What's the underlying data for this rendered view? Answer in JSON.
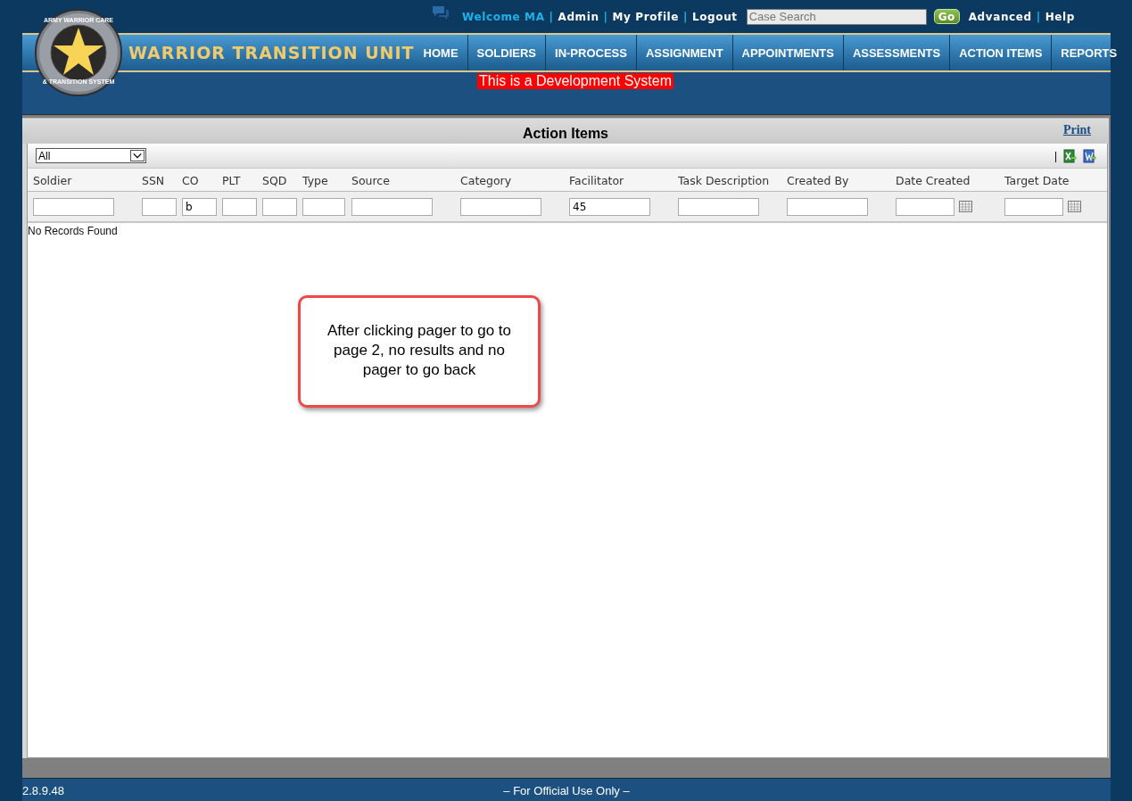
{
  "header": {
    "top_links": [
      {
        "kind": "welcome",
        "text": "Welcome MA"
      },
      {
        "kind": "sep",
        "text": "|"
      },
      {
        "kind": "link",
        "text": "Admin"
      },
      {
        "kind": "sep",
        "text": "|"
      },
      {
        "kind": "link",
        "text": "My Profile"
      },
      {
        "kind": "sep",
        "text": "|"
      },
      {
        "kind": "link",
        "text": "Logout"
      }
    ],
    "search": {
      "placeholder": "Case Search"
    },
    "go_button": "Go",
    "right_links": [
      {
        "kind": "link",
        "text": "Advanced"
      },
      {
        "kind": "sep",
        "text": "|"
      },
      {
        "kind": "link",
        "text": "Help"
      }
    ],
    "logo_ring_top": "ARMY WARRIOR CARE",
    "logo_ring_bottom": "& TRANSITION SYSTEM",
    "logo_text": "WARRIOR TRANSITION UNIT",
    "nav": [
      {
        "label": "HOME"
      },
      {
        "label": "SOLDIERS"
      },
      {
        "label": "IN-PROCESS"
      },
      {
        "label": "ASSIGNMENT"
      },
      {
        "label": "APPOINTMENTS"
      },
      {
        "label": "ASSESSMENTS"
      },
      {
        "label": "ACTION ITEMS"
      },
      {
        "label": "REPORTS"
      }
    ],
    "banner": "This is a Development System"
  },
  "panel": {
    "title": "Action Items",
    "print_link": "Print",
    "filter_select": "All",
    "toolbar_separator": "|",
    "columns": [
      {
        "label": "Soldier",
        "kind": "text"
      },
      {
        "label": "SSN",
        "kind": "text"
      },
      {
        "label": "CO",
        "kind": "text",
        "filter": "b"
      },
      {
        "label": "PLT",
        "kind": "text"
      },
      {
        "label": "SQD",
        "kind": "text"
      },
      {
        "label": "Type",
        "kind": "text"
      },
      {
        "label": "Source",
        "kind": "text"
      },
      {
        "label": "Category",
        "kind": "text"
      },
      {
        "label": "Facilitator",
        "kind": "text",
        "filter": "45"
      },
      {
        "label": "Task Description",
        "kind": "text"
      },
      {
        "label": "Created By",
        "kind": "text"
      },
      {
        "label": "Date Created",
        "kind": "date"
      },
      {
        "label": "Target Date",
        "kind": "date"
      }
    ],
    "empty_message": "No Records Found",
    "callout": "After clicking pager to go to page 2, no results and no pager to go back"
  },
  "footer": {
    "version": "2.8.9.48",
    "notice": "– For Official Use Only –"
  }
}
